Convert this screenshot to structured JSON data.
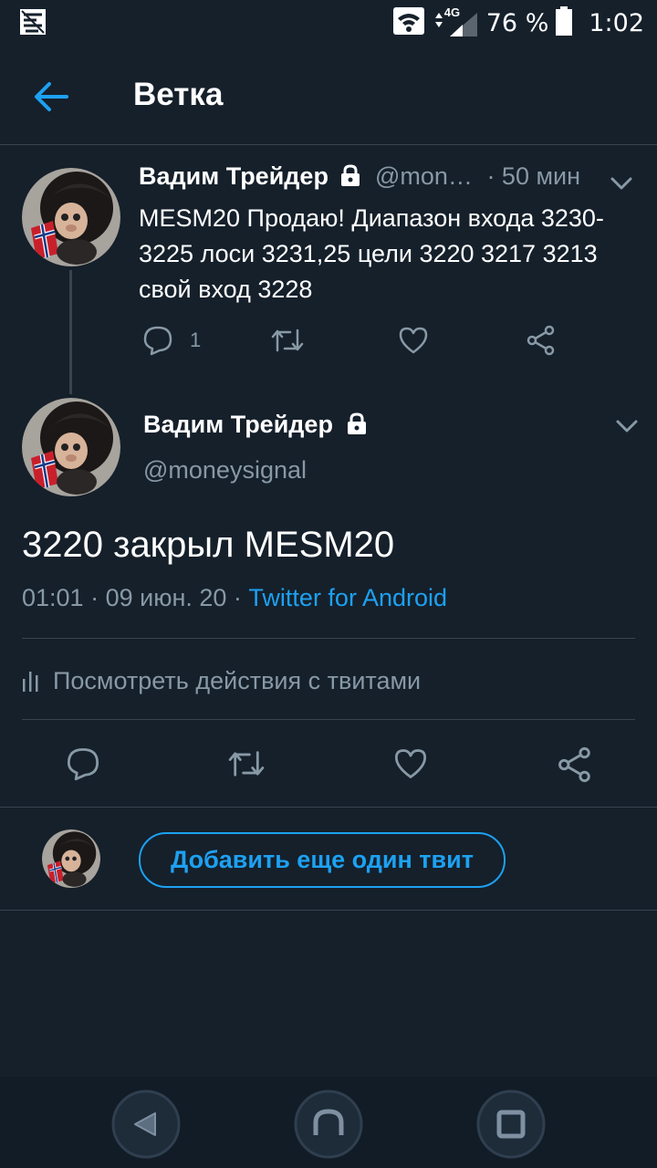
{
  "status_bar": {
    "network": "4G",
    "battery": "76 %",
    "time": "1:02",
    "icons": [
      "notification-icon",
      "wifi-icon",
      "signal-icon",
      "battery-icon"
    ]
  },
  "app_bar": {
    "title": "Ветка",
    "back_icon": "arrow-left-icon"
  },
  "parent_tweet": {
    "name": "Вадим Трейдер",
    "handle": "@mon…",
    "time": "· 50 мин",
    "text": "MESM20 Продаю! Диапазон входа 3230-3225 лоси 3231,25 цели 3220 3217 3213 свой вход 3228",
    "reply_count": "1"
  },
  "main_tweet": {
    "name": "Вадим Трейдер",
    "handle": "@moneysignal",
    "text": "3220 закрыл MESM20",
    "time": "01:01",
    "date": "09 июн. 20",
    "source": "Twitter for Android",
    "activity_label": "Посмотреть действия с твитами"
  },
  "compose": {
    "button_label": "Добавить еще один твит"
  },
  "colors": {
    "background": "#15202b",
    "accent": "#1da1f2",
    "muted": "#8899a6",
    "divider": "#38444d"
  }
}
